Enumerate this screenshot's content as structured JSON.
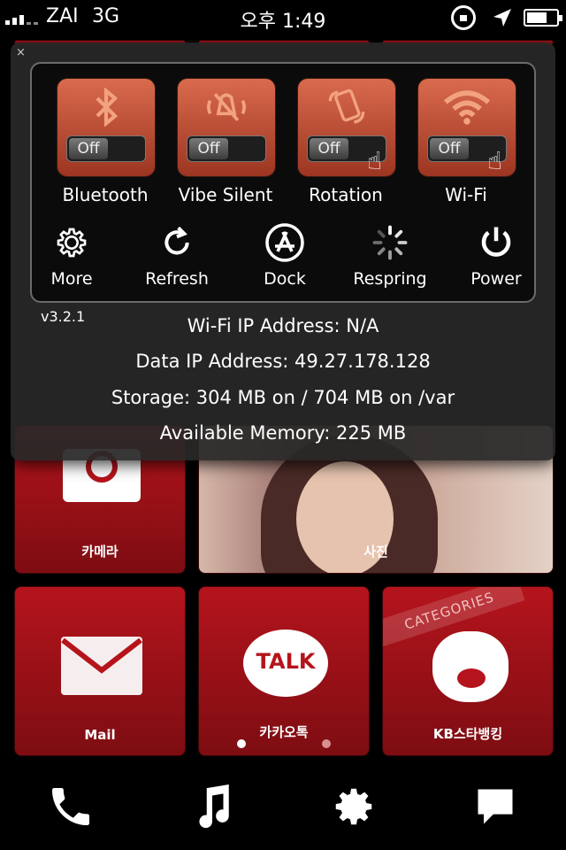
{
  "status_bar": {
    "carrier": "ZAI",
    "network": "3G",
    "time": "오후 1:49",
    "battery_level": 0.7
  },
  "overlay": {
    "close_label": "×",
    "toggles": [
      {
        "label": "Bluetooth",
        "state": "Off",
        "icon": "bluetooth-icon"
      },
      {
        "label": "Vibe Silent",
        "state": "Off",
        "icon": "vibe-silent-icon"
      },
      {
        "label": "Rotation",
        "state": "Off",
        "icon": "rotation-icon"
      },
      {
        "label": "Wi-Fi",
        "state": "Off",
        "icon": "wifi-icon"
      }
    ],
    "actions": [
      {
        "label": "More",
        "icon": "gear-icon"
      },
      {
        "label": "Refresh",
        "icon": "refresh-icon"
      },
      {
        "label": "Dock",
        "icon": "app-store-icon"
      },
      {
        "label": "Respring",
        "icon": "spinner-icon"
      },
      {
        "label": "Power",
        "icon": "power-icon"
      }
    ],
    "version": "v3.2.1",
    "info": {
      "wifi_ip": "Wi-Fi IP Address: N/A",
      "data_ip": "Data IP Address: 49.27.178.128",
      "storage": "Storage: 304 MB on / 704 MB on /var",
      "memory": "Available Memory: 225 MB"
    }
  },
  "home": {
    "camera_label": "카메라",
    "photos_label": "사진",
    "mail_label": "Mail",
    "kakaotalk_label": "카카오톡",
    "kakaotalk_icon_text": "TALK",
    "kbbank_label": "KB스타뱅킹",
    "categories_label": "CATEGORIES"
  },
  "dock": [
    {
      "icon": "phone-icon"
    },
    {
      "icon": "music-icon"
    },
    {
      "icon": "settings-icon"
    },
    {
      "icon": "messages-icon"
    }
  ],
  "colors": {
    "tile_red": "#b5141c",
    "toggle_orange": "#d96a4d"
  }
}
